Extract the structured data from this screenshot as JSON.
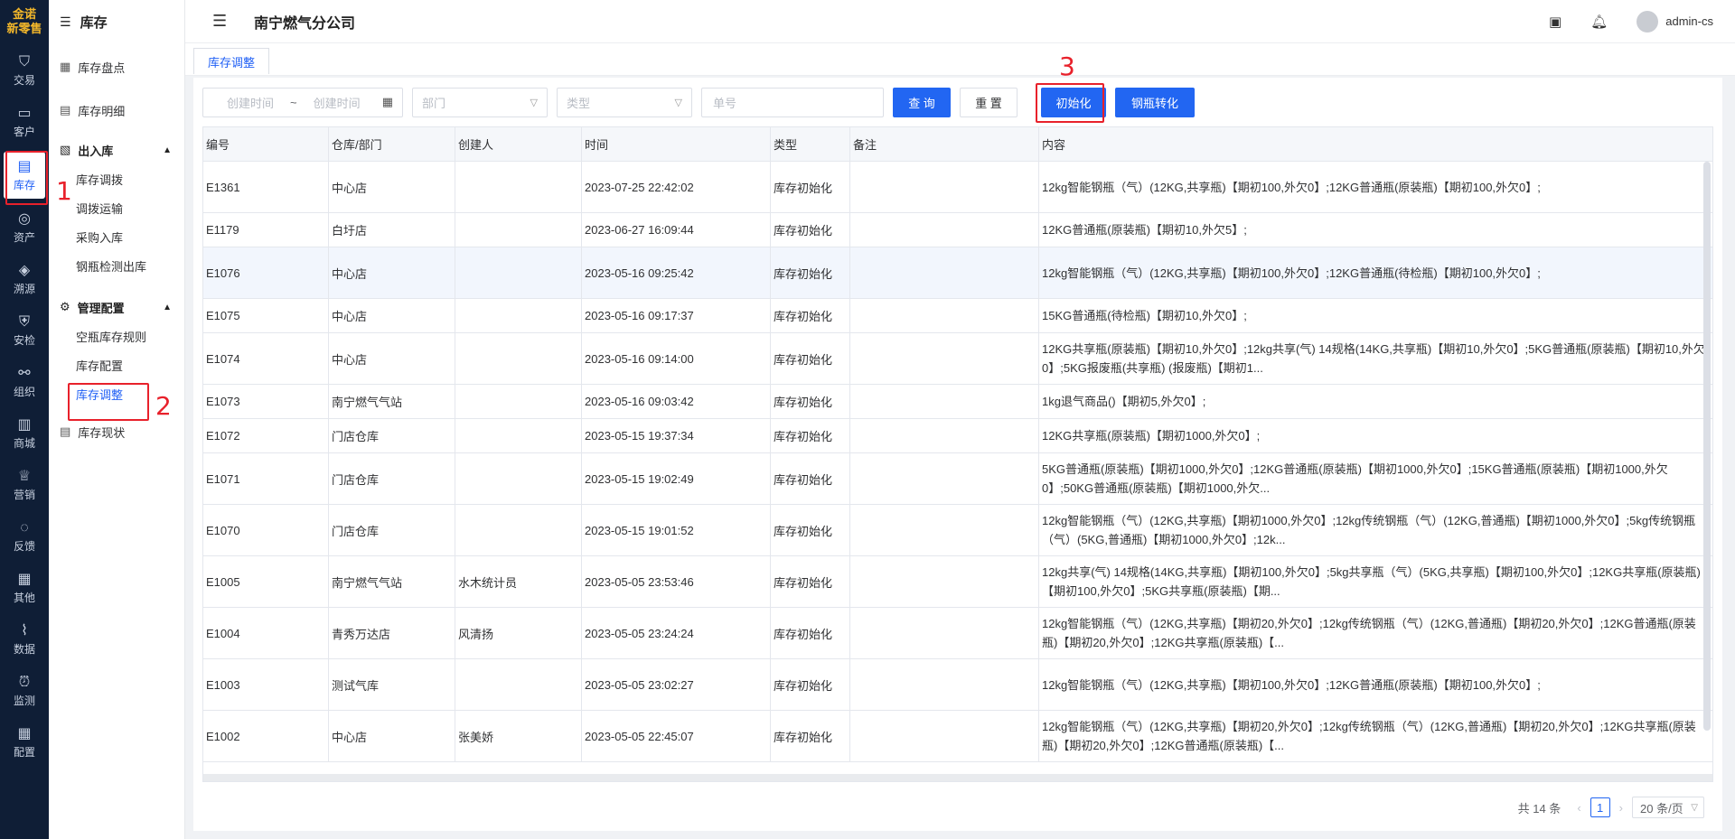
{
  "rail": {
    "logo_top": "金诺",
    "logo_bottom": "新零售",
    "items": [
      {
        "label": "交易",
        "icon": "bag-icon"
      },
      {
        "label": "客户",
        "icon": "id-card-icon"
      },
      {
        "label": "库存",
        "icon": "inventory-icon"
      },
      {
        "label": "资产",
        "icon": "bulb-icon"
      },
      {
        "label": "溯源",
        "icon": "compass-icon"
      },
      {
        "label": "安检",
        "icon": "shield-icon"
      },
      {
        "label": "组织",
        "icon": "org-icon"
      },
      {
        "label": "商城",
        "icon": "store-icon"
      },
      {
        "label": "营销",
        "icon": "trophy-icon"
      },
      {
        "label": "反馈",
        "icon": "chat-icon"
      },
      {
        "label": "其他",
        "icon": "grid-icon"
      },
      {
        "label": "数据",
        "icon": "chart-icon"
      },
      {
        "label": "监测",
        "icon": "alarm-icon"
      },
      {
        "label": "配置",
        "icon": "apps-icon"
      }
    ]
  },
  "sidebar": {
    "title": "库存",
    "top_items": [
      "库存盘点",
      "库存明细"
    ],
    "group1": {
      "label": "出入库",
      "items": [
        "库存调拨",
        "调拨运输",
        "采购入库",
        "钢瓶检测出库"
      ]
    },
    "group2": {
      "label": "管理配置",
      "items": [
        "空瓶库存规则",
        "库存配置",
        "库存调整"
      ]
    },
    "bottom_item": "库存现状"
  },
  "header": {
    "company": "南宁燃气分公司",
    "user": "admin-cs"
  },
  "tabs": [
    "库存调整"
  ],
  "filters": {
    "start_placeholder": "创建时间",
    "range_sep": "~",
    "end_placeholder": "创建时间",
    "dept_placeholder": "部门",
    "type_placeholder": "类型",
    "order_placeholder": "单号",
    "query_label": "查 询",
    "reset_label": "重 置",
    "init_label": "初始化",
    "convert_label": "钢瓶转化"
  },
  "annotations": [
    "1",
    "2",
    "3"
  ],
  "table": {
    "columns": [
      "编号",
      "仓库/部门",
      "创建人",
      "时间",
      "类型",
      "备注",
      "内容"
    ],
    "rows": [
      {
        "id": "E1361",
        "dept": "中心店",
        "creator": "",
        "time": "2023-07-25 22:42:02",
        "type": "库存初始化",
        "note": "",
        "content": "12kg智能钢瓶（气）(12KG,共享瓶)【期初100,外欠0】;12KG普通瓶(原装瓶)【期初100,外欠0】;"
      },
      {
        "id": "E1179",
        "dept": "白圩店",
        "creator": "",
        "time": "2023-06-27 16:09:44",
        "type": "库存初始化",
        "note": "",
        "content": "12KG普通瓶(原装瓶)【期初10,外欠5】;"
      },
      {
        "id": "E1076",
        "dept": "中心店",
        "creator": "",
        "time": "2023-05-16 09:25:42",
        "type": "库存初始化",
        "note": "",
        "content": "12kg智能钢瓶（气）(12KG,共享瓶)【期初100,外欠0】;12KG普通瓶(待检瓶)【期初100,外欠0】;"
      },
      {
        "id": "E1075",
        "dept": "中心店",
        "creator": "",
        "time": "2023-05-16 09:17:37",
        "type": "库存初始化",
        "note": "",
        "content": "15KG普通瓶(待检瓶)【期初10,外欠0】;"
      },
      {
        "id": "E1074",
        "dept": "中心店",
        "creator": "",
        "time": "2023-05-16 09:14:00",
        "type": "库存初始化",
        "note": "",
        "content": "12KG共享瓶(原装瓶)【期初10,外欠0】;12kg共享(气) 14规格(14KG,共享瓶)【期初10,外欠0】;5KG普通瓶(原装瓶)【期初10,外欠0】;5KG报废瓶(共享瓶) (报废瓶)【期初1..."
      },
      {
        "id": "E1073",
        "dept": "南宁燃气气站",
        "creator": "",
        "time": "2023-05-16 09:03:42",
        "type": "库存初始化",
        "note": "",
        "content": "1kg退气商品()【期初5,外欠0】;"
      },
      {
        "id": "E1072",
        "dept": "门店仓库",
        "creator": "",
        "time": "2023-05-15 19:37:34",
        "type": "库存初始化",
        "note": "",
        "content": "12KG共享瓶(原装瓶)【期初1000,外欠0】;"
      },
      {
        "id": "E1071",
        "dept": "门店仓库",
        "creator": "",
        "time": "2023-05-15 19:02:49",
        "type": "库存初始化",
        "note": "",
        "content": "5KG普通瓶(原装瓶)【期初1000,外欠0】;12KG普通瓶(原装瓶)【期初1000,外欠0】;15KG普通瓶(原装瓶)【期初1000,外欠0】;50KG普通瓶(原装瓶)【期初1000,外欠..."
      },
      {
        "id": "E1070",
        "dept": "门店仓库",
        "creator": "",
        "time": "2023-05-15 19:01:52",
        "type": "库存初始化",
        "note": "",
        "content": "12kg智能钢瓶（气）(12KG,共享瓶)【期初1000,外欠0】;12kg传统钢瓶（气）(12KG,普通瓶)【期初1000,外欠0】;5kg传统钢瓶（气）(5KG,普通瓶)【期初1000,外欠0】;12k..."
      },
      {
        "id": "E1005",
        "dept": "南宁燃气气站",
        "creator": "水木统计员",
        "time": "2023-05-05 23:53:46",
        "type": "库存初始化",
        "note": "",
        "content": "12kg共享(气) 14规格(14KG,共享瓶)【期初100,外欠0】;5kg共享瓶（气）(5KG,共享瓶)【期初100,外欠0】;12KG共享瓶(原装瓶)【期初100,外欠0】;5KG共享瓶(原装瓶)【期..."
      },
      {
        "id": "E1004",
        "dept": "青秀万达店",
        "creator": "风清扬",
        "time": "2023-05-05 23:24:24",
        "type": "库存初始化",
        "note": "",
        "content": "12kg智能钢瓶（气）(12KG,共享瓶)【期初20,外欠0】;12kg传统钢瓶（气）(12KG,普通瓶)【期初20,外欠0】;12KG普通瓶(原装瓶)【期初20,外欠0】;12KG共享瓶(原装瓶)【..."
      },
      {
        "id": "E1003",
        "dept": "测试气库",
        "creator": "",
        "time": "2023-05-05 23:02:27",
        "type": "库存初始化",
        "note": "",
        "content": "12kg智能钢瓶（气）(12KG,共享瓶)【期初100,外欠0】;12KG普通瓶(原装瓶)【期初100,外欠0】;"
      },
      {
        "id": "E1002",
        "dept": "中心店",
        "creator": "张美娇",
        "time": "2023-05-05 22:45:07",
        "type": "库存初始化",
        "note": "",
        "content": "12kg智能钢瓶（气）(12KG,共享瓶)【期初20,外欠0】;12kg传统钢瓶（气）(12KG,普通瓶)【期初20,外欠0】;12KG共享瓶(原装瓶)【期初20,外欠0】;12KG普通瓶(原装瓶)【..."
      }
    ]
  },
  "pagination": {
    "total": "共 14 条",
    "current": "1",
    "page_size": "20 条/页"
  }
}
